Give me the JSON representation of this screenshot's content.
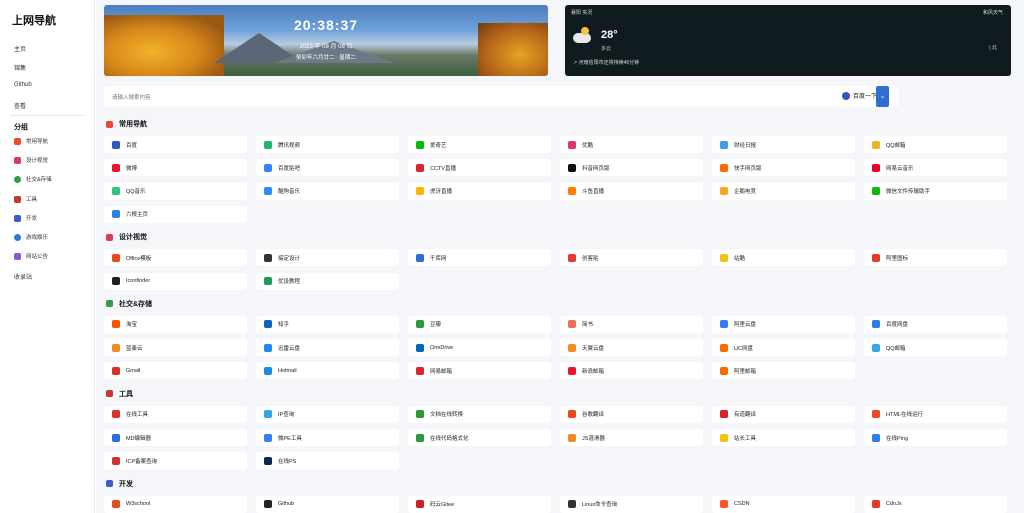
{
  "sidebar": {
    "brand": "上网导航",
    "nav": [
      "主页",
      "锦集",
      "Github",
      "查看"
    ],
    "group_title": "分组",
    "groups": [
      {
        "label": "常用导航",
        "icon": "fire-icon",
        "color": "#e84a3a"
      },
      {
        "label": "设计视觉",
        "icon": "design-icon",
        "color": "#d83c5a"
      },
      {
        "label": "社交&存储",
        "icon": "chat-icon",
        "color": "#2ea043"
      },
      {
        "label": "工具",
        "icon": "tools-icon",
        "color": "#c0392b"
      },
      {
        "label": "开发",
        "icon": "monitor-icon",
        "color": "#3b5ac4"
      },
      {
        "label": "游戏娱乐",
        "icon": "globe-icon",
        "color": "#2a7ad8"
      },
      {
        "label": "网站公告",
        "icon": "announce-icon",
        "color": "#8a5bd6"
      }
    ],
    "footer_link": "收录站"
  },
  "header": {
    "time": "20:38:37",
    "date": "2023 年 08 月 08 日",
    "lunar": "癸卯年六月廿二 · 星期二"
  },
  "weather": {
    "city": "襄阳 实况",
    "source": "和风天气",
    "temp": "28°",
    "desc": "多云",
    "alert": "↗ 河南信阳市还将持续45分钟",
    "right": "| 北"
  },
  "search": {
    "placeholder": "请输入搜索内容",
    "engine": "百度一下",
    "dropdown_icon": "chevron-down-icon"
  },
  "sections": [
    {
      "title": "常用导航",
      "icon": "fire-icon",
      "color": "#e84a3a",
      "items": [
        {
          "label": "百度",
          "color": "#2b57c7"
        },
        {
          "label": "腾讯视频",
          "color": "#24b36b"
        },
        {
          "label": "爱奇艺",
          "color": "#00be06"
        },
        {
          "label": "优酷",
          "color": "#e0356a"
        },
        {
          "label": "财经日报",
          "color": "#3aa0e8"
        },
        {
          "label": "QQ邮箱",
          "color": "#f1b32b"
        },
        {
          "label": "微博",
          "color": "#e6162d"
        },
        {
          "label": "百度贴吧",
          "color": "#3385ff"
        },
        {
          "label": "CCTV直播",
          "color": "#d8252d"
        },
        {
          "label": "抖音网页版",
          "color": "#111111"
        },
        {
          "label": "快手网页版",
          "color": "#ff6a00"
        },
        {
          "label": "网易云音乐",
          "color": "#e60026"
        },
        {
          "label": "QQ音乐",
          "color": "#31c27c"
        },
        {
          "label": "酷狗音乐",
          "color": "#2c8ef8"
        },
        {
          "label": "虎牙直播",
          "color": "#ffb300"
        },
        {
          "label": "斗鱼直播",
          "color": "#ff7a00"
        },
        {
          "label": "企鹅电竞",
          "color": "#f5a623"
        },
        {
          "label": "微信文件传输助手",
          "color": "#09bb07"
        },
        {
          "label": "六根主页",
          "color": "#2a82e4"
        }
      ]
    },
    {
      "title": "设计视觉",
      "icon": "design-icon",
      "color": "#d83c5a",
      "items": [
        {
          "label": "Office模板",
          "color": "#e64a19"
        },
        {
          "label": "搞定设计",
          "color": "#333333"
        },
        {
          "label": "千库网",
          "color": "#2d6cdf"
        },
        {
          "label": "创客贴",
          "color": "#e53935"
        },
        {
          "label": "站酷",
          "color": "#f4c20d"
        },
        {
          "label": "阿里图标",
          "color": "#e23c28"
        },
        {
          "label": "Iconfinder",
          "color": "#222222"
        },
        {
          "label": "优设教程",
          "color": "#1d9a5f"
        }
      ]
    },
    {
      "title": "社交&存储",
      "icon": "chat-icon",
      "color": "#2ea043",
      "items": [
        {
          "label": "淘宝",
          "color": "#ff5000"
        },
        {
          "label": "知乎",
          "color": "#0a66c2"
        },
        {
          "label": "豆瓣",
          "color": "#2e963d"
        },
        {
          "label": "简书",
          "color": "#ea6f5a"
        },
        {
          "label": "阿里云盘",
          "color": "#3b7cf6"
        },
        {
          "label": "百度网盘",
          "color": "#2e7de1"
        },
        {
          "label": "蓝奏云",
          "color": "#f08a24"
        },
        {
          "label": "迅雷云盘",
          "color": "#1e8ae8"
        },
        {
          "label": "OneDrive",
          "color": "#0364b8"
        },
        {
          "label": "天翼云盘",
          "color": "#f28c28"
        },
        {
          "label": "UC网盘",
          "color": "#ff6a00"
        },
        {
          "label": "QQ邮箱",
          "color": "#3aa5e0"
        },
        {
          "label": "Gmail",
          "color": "#d93025"
        },
        {
          "label": "Hotmail",
          "color": "#1b8ce6"
        },
        {
          "label": "网易邮箱",
          "color": "#d8252d"
        },
        {
          "label": "新浪邮箱",
          "color": "#e6162d"
        },
        {
          "label": "阿里邮箱",
          "color": "#ff6a00"
        }
      ]
    },
    {
      "title": "工具",
      "icon": "tools-icon",
      "color": "#c0392b",
      "items": [
        {
          "label": "在线工具",
          "color": "#d83030"
        },
        {
          "label": "IP查询",
          "color": "#3aa0e8"
        },
        {
          "label": "文档在线转换",
          "color": "#2e963d"
        },
        {
          "label": "谷歌翻译",
          "color": "#e64a19"
        },
        {
          "label": "有道翻译",
          "color": "#d8252d"
        },
        {
          "label": "HTML在线运行",
          "color": "#e44d26"
        },
        {
          "label": "MD编辑器",
          "color": "#2d6cdf"
        },
        {
          "label": "微PE工具",
          "color": "#3b7cf6"
        },
        {
          "label": "在线代码格式化",
          "color": "#2e963d"
        },
        {
          "label": "JS混淆器",
          "color": "#f08a24"
        },
        {
          "label": "站长工具",
          "color": "#f4c20d"
        },
        {
          "label": "在线Ping",
          "color": "#2a82e4"
        },
        {
          "label": "ICP备案查询",
          "color": "#d83030"
        },
        {
          "label": "在线PS",
          "color": "#0a2a54"
        }
      ]
    },
    {
      "title": "开发",
      "icon": "monitor-icon",
      "color": "#3b5ac4",
      "items": [
        {
          "label": "W3school",
          "color": "#e44d26"
        },
        {
          "label": "Github",
          "color": "#222222"
        },
        {
          "label": "码云Gitee",
          "color": "#c71d23"
        },
        {
          "label": "Linux命令查询",
          "color": "#333333"
        },
        {
          "label": "CSDN",
          "color": "#fc5531"
        },
        {
          "label": "CdnJs",
          "color": "#e23c28"
        }
      ]
    }
  ]
}
